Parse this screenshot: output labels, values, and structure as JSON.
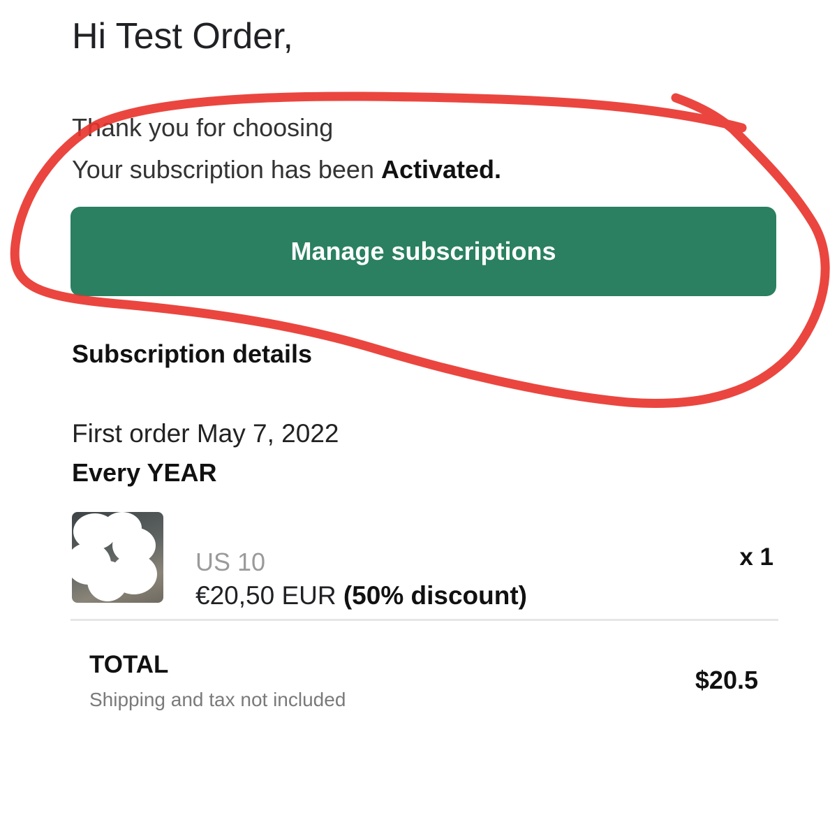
{
  "greeting": "Hi Test Order,",
  "thank_you": "Thank you for choosing",
  "status": {
    "prefix": "Your subscription has been ",
    "value": "Activated."
  },
  "manage_button": "Manage subscriptions",
  "details": {
    "title": "Subscription details",
    "first_order": "First order May 7, 2022",
    "frequency": "Every YEAR"
  },
  "item": {
    "variant": "US 10",
    "price": "€20,50 EUR ",
    "discount": "(50% discount)",
    "quantity": "x 1"
  },
  "total": {
    "label": "TOTAL",
    "note": "Shipping and tax not included",
    "amount": "$20.5"
  },
  "colors": {
    "button": "#2a8060",
    "annotation": "#e8322a"
  }
}
